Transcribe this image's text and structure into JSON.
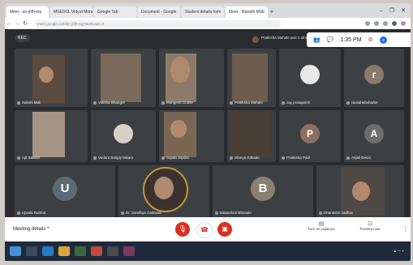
{
  "browser": {
    "tabs": [
      {
        "label": "Meet - an-jhfh-nig",
        "active": true
      },
      {
        "label": "MSEDCL Vidyut Mitra",
        "active": false
      },
      {
        "label": "Google Tab",
        "active": false
      },
      {
        "label": "Document - Google",
        "active": false
      },
      {
        "label": "Student details form",
        "active": false
      },
      {
        "label": "Meet - Marathi MSE",
        "active": false
      }
    ],
    "new_tab": "+",
    "url": "meet.google.com/an-jhfh-nig?authuser=0",
    "window_controls": [
      "–",
      "❐",
      "✕"
    ]
  },
  "meet": {
    "rec_label": "REC",
    "presenter": "Pratiksha Mahale and 1 others",
    "time": "1:35 PM",
    "user_initial": "S"
  },
  "participants": [
    {
      "name": "Sakshi Mali",
      "type": "video",
      "bg": "#5b4a3f"
    },
    {
      "name": "Vidisha Bhangre",
      "type": "video",
      "bg": "#7a6a5c"
    },
    {
      "name": "Mangesh Godse",
      "type": "video",
      "bg": "#8d7a6a"
    },
    {
      "name": "Pratiksha Mahale",
      "type": "video",
      "bg": "#6e5c4e"
    },
    {
      "name": "Jay pratapsinh",
      "type": "avatar",
      "letter": "",
      "color": "#e8e8e8"
    },
    {
      "name": "raosahebsharbe",
      "type": "avatar",
      "letter": "r",
      "color": "#8a7a6a"
    },
    {
      "name": "Ajit Sawant",
      "type": "video",
      "bg": "#a59584"
    },
    {
      "name": "Vedant Sanjay Nikam",
      "type": "avatar",
      "letter": "",
      "color": "#d6d0c6"
    },
    {
      "name": "Sujata Jaydev",
      "type": "video",
      "bg": "#7a6655"
    },
    {
      "name": "Shreya Kakade",
      "type": "video",
      "bg": "#4a3f37"
    },
    {
      "name": "Pratiksha Patil",
      "type": "avatar",
      "letter": "P",
      "color": "#8d6e63"
    },
    {
      "name": "Anjali Desai",
      "type": "avatar",
      "letter": "A",
      "color": "#6d6d6d"
    },
    {
      "name": "Ujwala Rathod",
      "type": "avatar",
      "letter": "U",
      "color": "#5c6b73"
    },
    {
      "name": "Dr. Sandhya Gaikwad",
      "type": "video",
      "bg": "#3b3230"
    },
    {
      "name": "Balasaheb Bhosale",
      "type": "avatar",
      "letter": "B",
      "color": "#8a7f74"
    },
    {
      "name": "Dhanashri Jadhav",
      "type": "video",
      "bg": "#4f4844"
    }
  ],
  "bottom": {
    "meeting_details": "Meeting details",
    "turn_on_captions": "Turn on captions",
    "present_now": "Present now",
    "more": "⋮"
  },
  "colors": {
    "hangup": "#d93025",
    "tile": "#3c4043"
  }
}
